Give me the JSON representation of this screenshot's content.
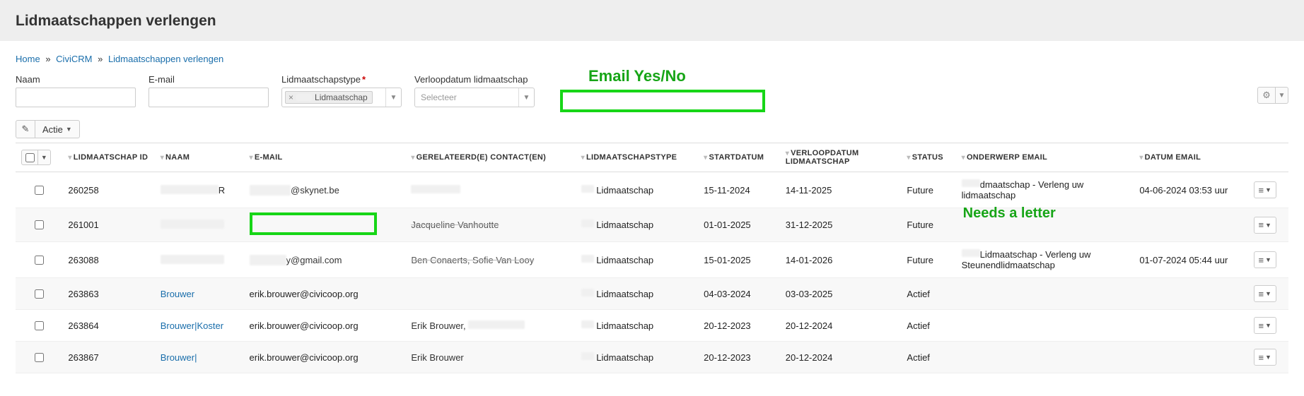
{
  "page": {
    "title": "Lidmaatschappen verlengen"
  },
  "breadcrumb": {
    "home": "Home",
    "civicrm": "CiviCRM",
    "current": "Lidmaatschappen verlengen",
    "sep": "»"
  },
  "filters": {
    "naam_label": "Naam",
    "email_label": "E-mail",
    "type_label": "Lidmaatschapstype",
    "type_tag": "Lidmaatschap",
    "verloop_label": "Verloopdatum lidmaatschap",
    "verloop_placeholder": "Selecteer"
  },
  "annotations": {
    "email_yesno": "Email Yes/No",
    "needs_letter": "Needs a letter"
  },
  "actions": {
    "actie_label": "Actie"
  },
  "table": {
    "headers": {
      "id": "LIDMAATSCHAP ID",
      "naam": "NAAM",
      "email": "E-MAIL",
      "gerel": "GERELATEERD(E) CONTACT(EN)",
      "type": "LIDMAATSCHAPSTYPE",
      "start": "STARTDATUM",
      "verloop": "VERLOOPDATUM LIDMAATSCHAP",
      "status": "STATUS",
      "onderwerp": "ONDERWERP EMAIL",
      "datum_email": "DATUM EMAIL"
    },
    "rows": [
      {
        "id": "260258",
        "naam_redacted": true,
        "naam_suffix": "R",
        "email_prefix_redacted": true,
        "email_visible": "@skynet.be",
        "email_redact_text": "xxxxxxxxx",
        "gerel_redacted": true,
        "type_suffix": "Lidmaatschap",
        "start": "15-11-2024",
        "verloop": "14-11-2025",
        "status": "Future",
        "onderwerp": "dmaatschap - Verleng uw lidmaatschap",
        "onderwerp_redacted": true,
        "datum_email": "04-06-2024 03:53 uur"
      },
      {
        "id": "261001",
        "naam_redacted": true,
        "email_annot_box": true,
        "gerel_text": "Jacqueline Vanhoutte",
        "gerel_strike": true,
        "type_suffix": "Lidmaatschap",
        "start": "01-01-2025",
        "verloop": "31-12-2025",
        "status": "Future",
        "onderwerp_annot": true,
        "datum_email": ""
      },
      {
        "id": "263088",
        "naam_redacted": true,
        "email_prefix_redacted": true,
        "email_visible": "y@gmail.com",
        "email_redact_text": "xxxxxxxx",
        "gerel_text": "Ben Conaerts, Sofie Van Looy",
        "gerel_strike": true,
        "type_suffix": "Lidmaatschap",
        "start": "15-01-2025",
        "verloop": "14-01-2026",
        "status": "Future",
        "onderwerp": "Lidmaatschap - Verleng uw Steunendlidmaatschap",
        "onderwerp_redacted": true,
        "datum_email": "01-07-2024 05:44 uur"
      },
      {
        "id": "263863",
        "naam": "Brouwer",
        "naam_link": true,
        "email": "erik.brouwer@civicoop.org",
        "gerel_text": "",
        "type_suffix": "Lidmaatschap",
        "start": "04-03-2024",
        "verloop": "03-03-2025",
        "status": "Actief",
        "onderwerp": "",
        "datum_email": ""
      },
      {
        "id": "263864",
        "naam": "Brouwer|Koster",
        "naam_link": true,
        "email": "erik.brouwer@civicoop.org",
        "gerel_text": "Erik Brouwer, ",
        "gerel_redact_suffix": true,
        "type_suffix": "Lidmaatschap",
        "start": "20-12-2023",
        "verloop": "20-12-2024",
        "status": "Actief",
        "onderwerp": "",
        "datum_email": ""
      },
      {
        "id": "263867",
        "naam": "Brouwer|",
        "naam_link": true,
        "email": "erik.brouwer@civicoop.org",
        "gerel_text": "Erik Brouwer",
        "type_suffix": "Lidmaatschap",
        "start": "20-12-2023",
        "verloop": "20-12-2024",
        "status": "Actief",
        "onderwerp": "",
        "datum_email": ""
      }
    ]
  }
}
